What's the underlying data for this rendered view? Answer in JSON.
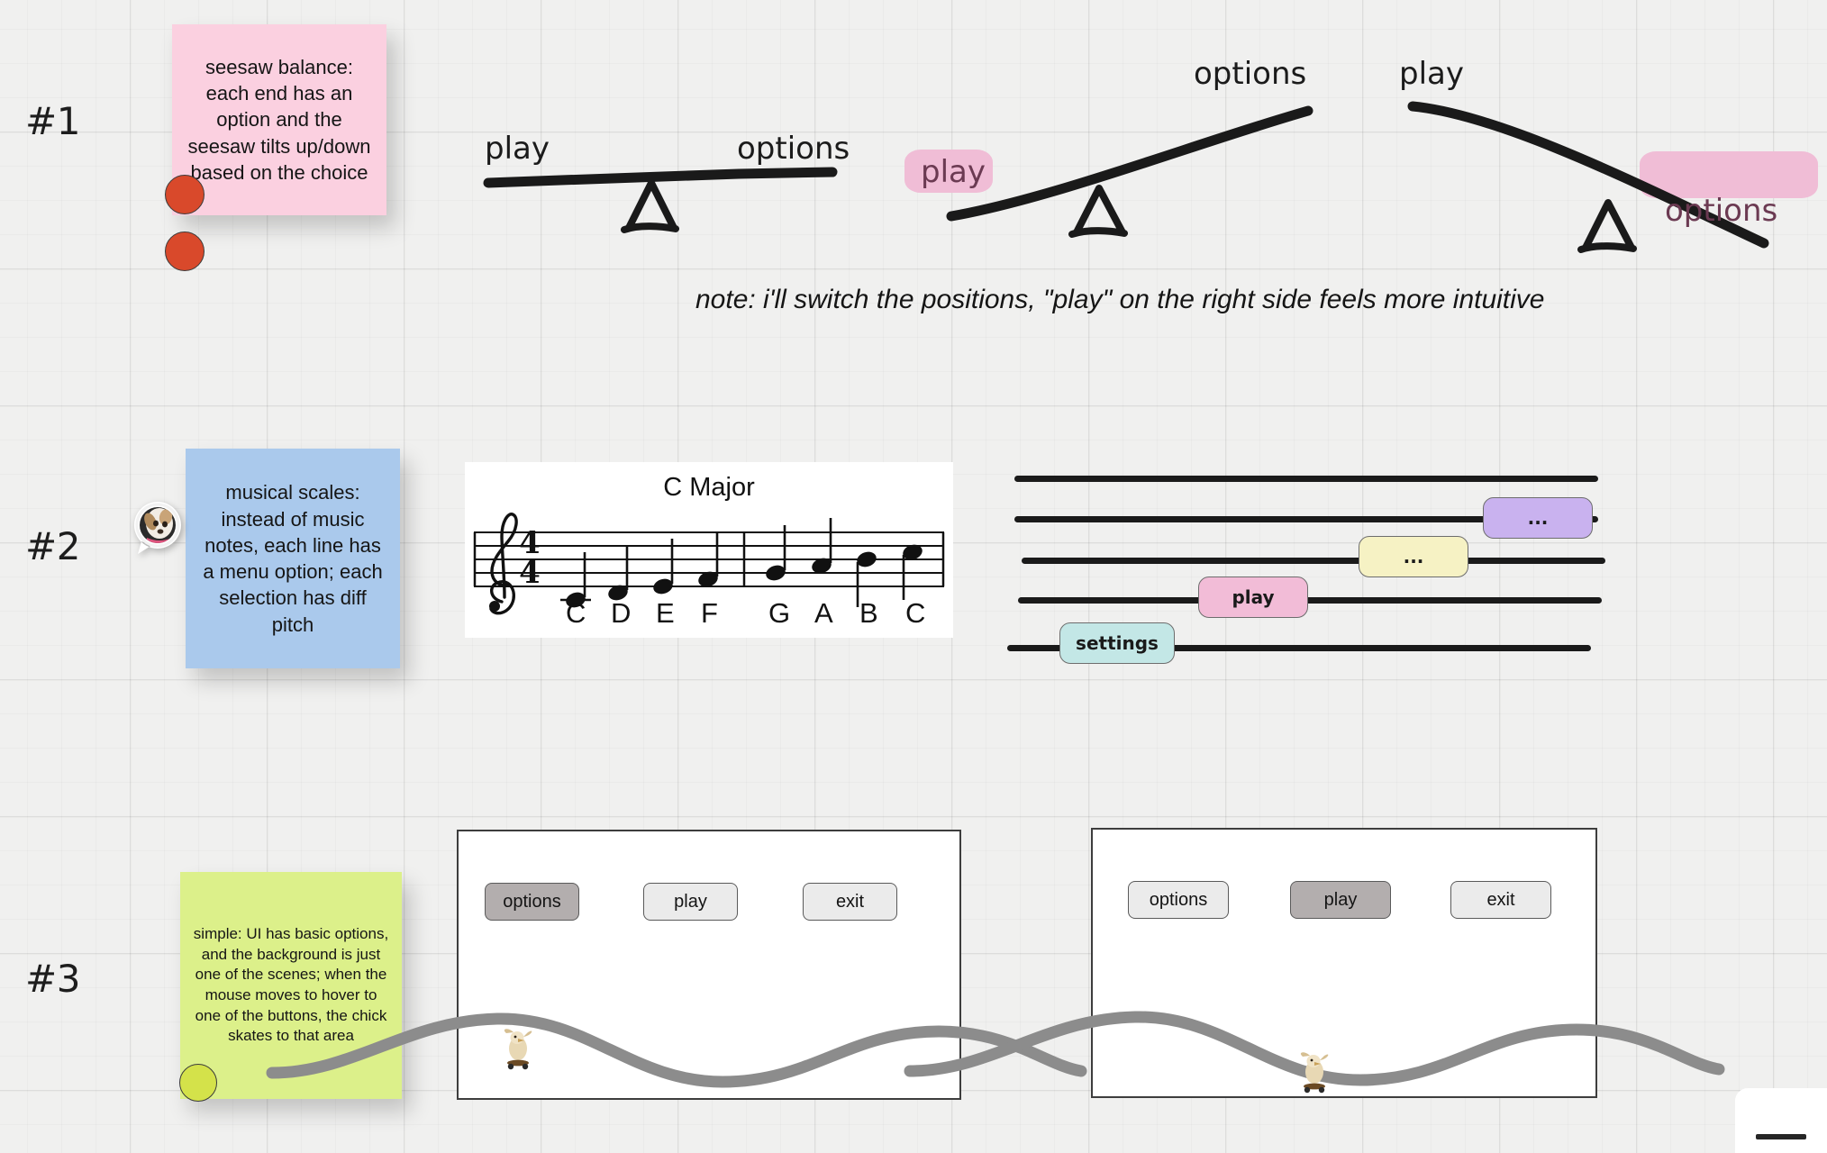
{
  "board": {
    "background_color": "#f0f0ef",
    "grid": true
  },
  "rows": [
    {
      "label": "#1"
    },
    {
      "label": "#2"
    },
    {
      "label": "#3"
    }
  ],
  "section1": {
    "sticky": {
      "text": "seesaw balance: each end has an option and the seesaw tilts up/down based on the choice",
      "color": "#fbd0e0",
      "dots": [
        {
          "color": "#d9492b"
        },
        {
          "color": "#d9492b"
        }
      ]
    },
    "seesaws": [
      {
        "name": "balanced",
        "left_label": "play",
        "right_label": "options",
        "left_highlighted": false,
        "right_highlighted": false,
        "state": "level"
      },
      {
        "name": "tilt-right-up",
        "left_label": "play",
        "right_label": "options",
        "left_highlighted": true,
        "right_highlighted": false,
        "state": "left-down"
      },
      {
        "name": "tilt-right-down",
        "left_label": "play",
        "right_label": "options",
        "left_highlighted": false,
        "right_highlighted": true,
        "state": "right-down"
      }
    ],
    "note": "note: i'll switch the positions, \"play\" on the right side feels more intuitive"
  },
  "section2": {
    "sticky": {
      "text": "musical scales: instead of music notes, each line has a menu option; each selection has diff pitch",
      "color": "#aac9ec"
    },
    "avatar": {
      "name": "dog-avatar"
    },
    "score": {
      "title": "C Major",
      "time_signature": "4/4",
      "clef": "treble",
      "notes": [
        "C",
        "D",
        "E",
        "F",
        "G",
        "A",
        "B",
        "C"
      ]
    },
    "staff_menu": {
      "line_count": 5,
      "chips": [
        {
          "label": "...",
          "color": "#c9b2ef",
          "line": 2
        },
        {
          "label": "...",
          "color": "#f6f2c4",
          "line": 3
        },
        {
          "label": "play",
          "color": "#f2bcd7",
          "line": 4
        },
        {
          "label": "settings",
          "color": "#c3e7e6",
          "line": 5
        }
      ]
    }
  },
  "section3": {
    "sticky": {
      "text": "simple: UI has basic options, and the background is just one of the scenes; when the mouse moves to hover to one of the buttons, the chick skates to that area",
      "color": "#dcf08a",
      "dot_color": "#d4e24a"
    },
    "frames": [
      {
        "name": "frame-options-hover",
        "buttons": [
          {
            "label": "options",
            "active": true
          },
          {
            "label": "play",
            "active": false
          },
          {
            "label": "exit",
            "active": false
          }
        ],
        "character": "chick-on-skateboard",
        "character_position": "under-options"
      },
      {
        "name": "frame-play-hover",
        "buttons": [
          {
            "label": "options",
            "active": false
          },
          {
            "label": "play",
            "active": true
          },
          {
            "label": "exit",
            "active": false
          }
        ],
        "character": "chick-on-skateboard",
        "character_position": "under-play"
      }
    ]
  }
}
